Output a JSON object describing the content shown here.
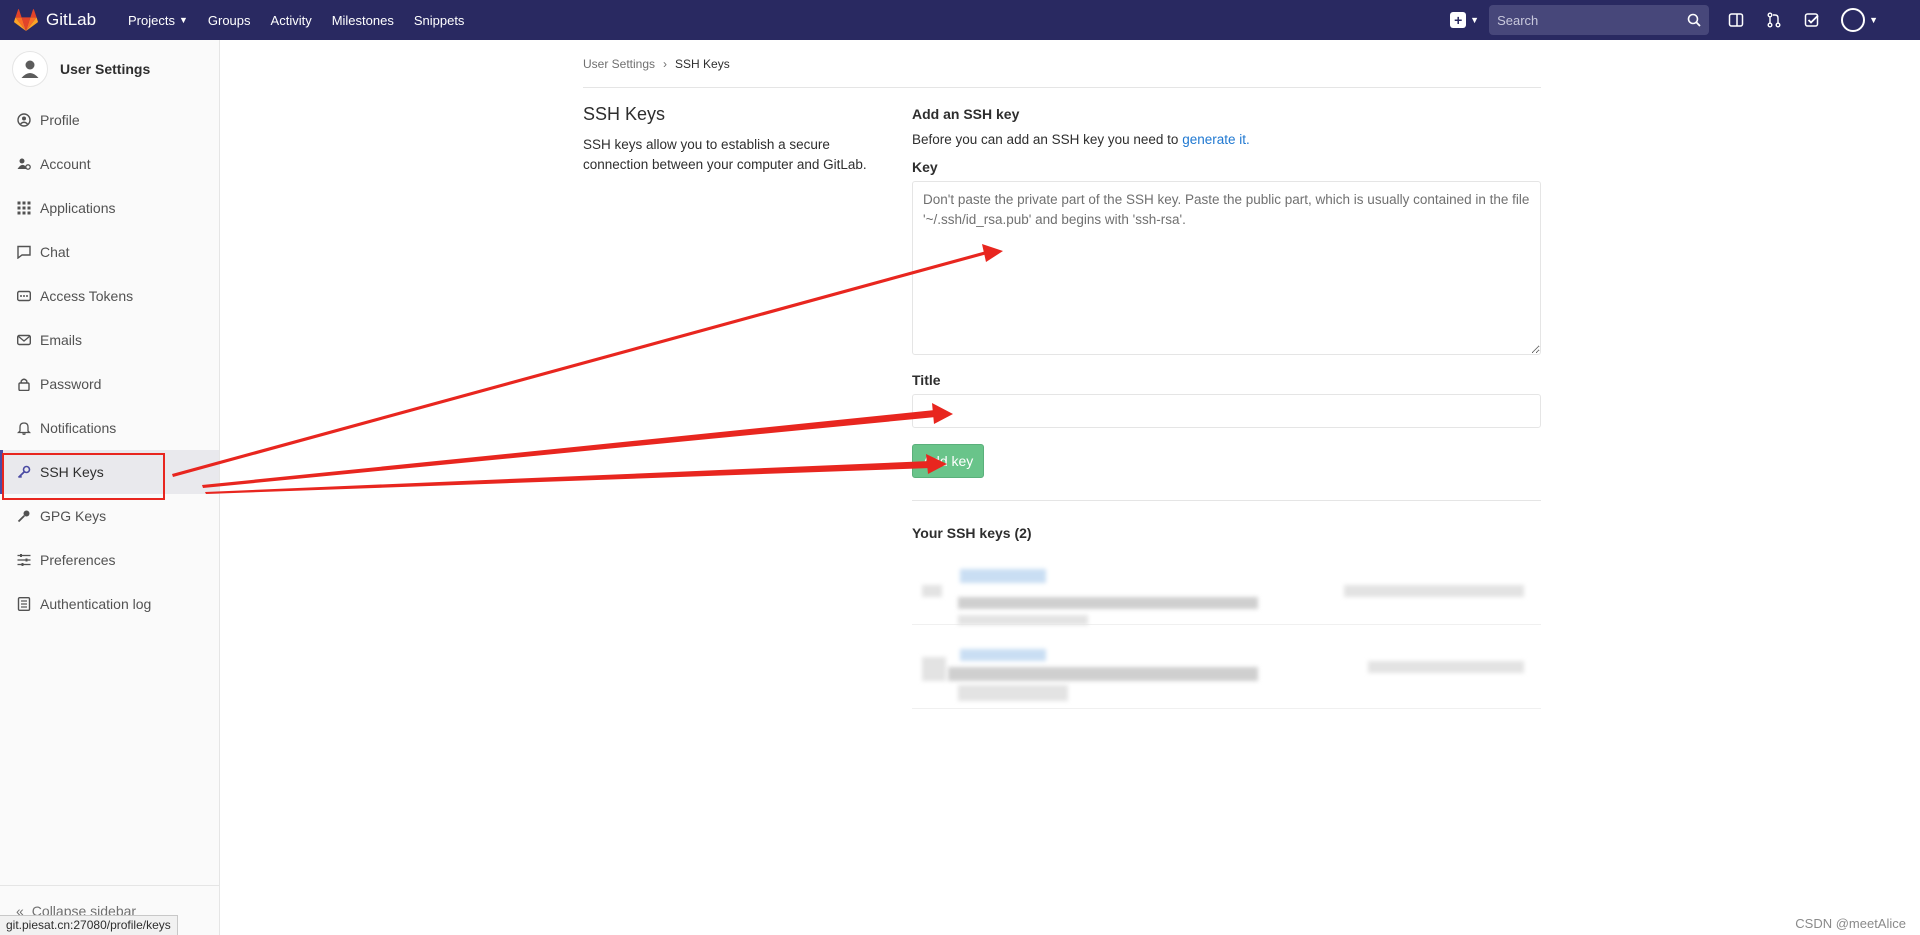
{
  "navbar": {
    "brand": "GitLab",
    "links": [
      {
        "label": "Projects",
        "has_dropdown": true
      },
      {
        "label": "Groups"
      },
      {
        "label": "Activity"
      },
      {
        "label": "Milestones"
      },
      {
        "label": "Snippets"
      }
    ],
    "search_placeholder": "Search",
    "icons": [
      "plus-icon",
      "sidebar-toggle-icon",
      "merge-request-icon",
      "todo-icon",
      "avatar"
    ],
    "bg_color": "#292961"
  },
  "sidebar": {
    "title": "User Settings",
    "items": [
      {
        "label": "Profile",
        "icon": "profile-icon"
      },
      {
        "label": "Account",
        "icon": "account-icon"
      },
      {
        "label": "Applications",
        "icon": "applications-icon"
      },
      {
        "label": "Chat",
        "icon": "chat-icon"
      },
      {
        "label": "Access Tokens",
        "icon": "token-icon"
      },
      {
        "label": "Emails",
        "icon": "mail-icon"
      },
      {
        "label": "Password",
        "icon": "lock-icon"
      },
      {
        "label": "Notifications",
        "icon": "bell-icon"
      },
      {
        "label": "SSH Keys",
        "icon": "key-icon",
        "active": true
      },
      {
        "label": "GPG Keys",
        "icon": "key-icon"
      },
      {
        "label": "Preferences",
        "icon": "preferences-icon"
      },
      {
        "label": "Authentication log",
        "icon": "log-icon"
      }
    ],
    "collapse_label": "Collapse sidebar"
  },
  "status_bar": {
    "url": "git.piesat.cn:27080/profile/keys"
  },
  "breadcrumb": {
    "parent": "User Settings",
    "current": "SSH Keys"
  },
  "left": {
    "title": "SSH Keys",
    "description": "SSH keys allow you to establish a secure connection between your computer and GitLab."
  },
  "form": {
    "heading": "Add an SSH key",
    "before_text": "Before you can add an SSH key you need to ",
    "link_text": "generate it.",
    "key_label": "Key",
    "key_placeholder": "Don't paste the private part of the SSH key. Paste the public part, which is usually contained in the file '~/.ssh/id_rsa.pub' and begins with 'ssh-rsa'.",
    "title_label": "Title",
    "title_value": "",
    "add_button": "Add key",
    "add_button_color": "#69c48a"
  },
  "keys": {
    "heading": "Your SSH keys (2)"
  },
  "watermark": "CSDN @meetAlice",
  "annotation_color": "#e8261f"
}
